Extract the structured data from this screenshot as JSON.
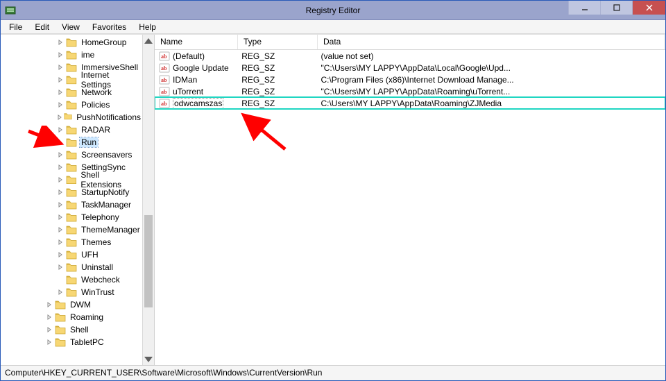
{
  "window": {
    "title": "Registry Editor"
  },
  "menu": {
    "file": "File",
    "edit": "Edit",
    "view": "View",
    "favorites": "Favorites",
    "help": "Help"
  },
  "tree": {
    "items": [
      {
        "label": "HomeGroup",
        "depth": 5,
        "expander": "closed"
      },
      {
        "label": "ime",
        "depth": 5,
        "expander": "closed"
      },
      {
        "label": "ImmersiveShell",
        "depth": 5,
        "expander": "closed"
      },
      {
        "label": "Internet Settings",
        "depth": 5,
        "expander": "closed"
      },
      {
        "label": "Network",
        "depth": 5,
        "expander": "closed"
      },
      {
        "label": "Policies",
        "depth": 5,
        "expander": "closed"
      },
      {
        "label": "PushNotifications",
        "depth": 5,
        "expander": "closed"
      },
      {
        "label": "RADAR",
        "depth": 5,
        "expander": "closed"
      },
      {
        "label": "Run",
        "depth": 5,
        "expander": "none",
        "selected": true
      },
      {
        "label": "Screensavers",
        "depth": 5,
        "expander": "closed"
      },
      {
        "label": "SettingSync",
        "depth": 5,
        "expander": "closed"
      },
      {
        "label": "Shell Extensions",
        "depth": 5,
        "expander": "closed"
      },
      {
        "label": "StartupNotify",
        "depth": 5,
        "expander": "closed"
      },
      {
        "label": "TaskManager",
        "depth": 5,
        "expander": "closed"
      },
      {
        "label": "Telephony",
        "depth": 5,
        "expander": "closed"
      },
      {
        "label": "ThemeManager",
        "depth": 5,
        "expander": "closed"
      },
      {
        "label": "Themes",
        "depth": 5,
        "expander": "closed"
      },
      {
        "label": "UFH",
        "depth": 5,
        "expander": "closed"
      },
      {
        "label": "Uninstall",
        "depth": 5,
        "expander": "closed"
      },
      {
        "label": "Webcheck",
        "depth": 5,
        "expander": "none"
      },
      {
        "label": "WinTrust",
        "depth": 5,
        "expander": "closed"
      },
      {
        "label": "DWM",
        "depth": 4,
        "expander": "closed"
      },
      {
        "label": "Roaming",
        "depth": 4,
        "expander": "closed"
      },
      {
        "label": "Shell",
        "depth": 4,
        "expander": "closed"
      },
      {
        "label": "TabletPC",
        "depth": 4,
        "expander": "closed"
      }
    ]
  },
  "list": {
    "columns": {
      "name": "Name",
      "type": "Type",
      "data": "Data"
    },
    "widths": {
      "name": 120,
      "type": 115,
      "data": 500
    },
    "rows": [
      {
        "name": "(Default)",
        "type": "REG_SZ",
        "data": "(value not set)"
      },
      {
        "name": "Google Update",
        "type": "REG_SZ",
        "data": "\"C:\\Users\\MY LAPPY\\AppData\\Local\\Google\\Upd..."
      },
      {
        "name": "IDMan",
        "type": "REG_SZ",
        "data": "C:\\Program Files (x86)\\Internet Download Manage..."
      },
      {
        "name": "uTorrent",
        "type": "REG_SZ",
        "data": "\"C:\\Users\\MY LAPPY\\AppData\\Roaming\\uTorrent..."
      },
      {
        "name": "odwcamszas",
        "type": "REG_SZ",
        "data": "C:\\Users\\MY LAPPY\\AppData\\Roaming\\ZJMedia",
        "selected": true
      }
    ]
  },
  "statusbar": {
    "path": "Computer\\HKEY_CURRENT_USER\\Software\\Microsoft\\Windows\\CurrentVersion\\Run"
  }
}
